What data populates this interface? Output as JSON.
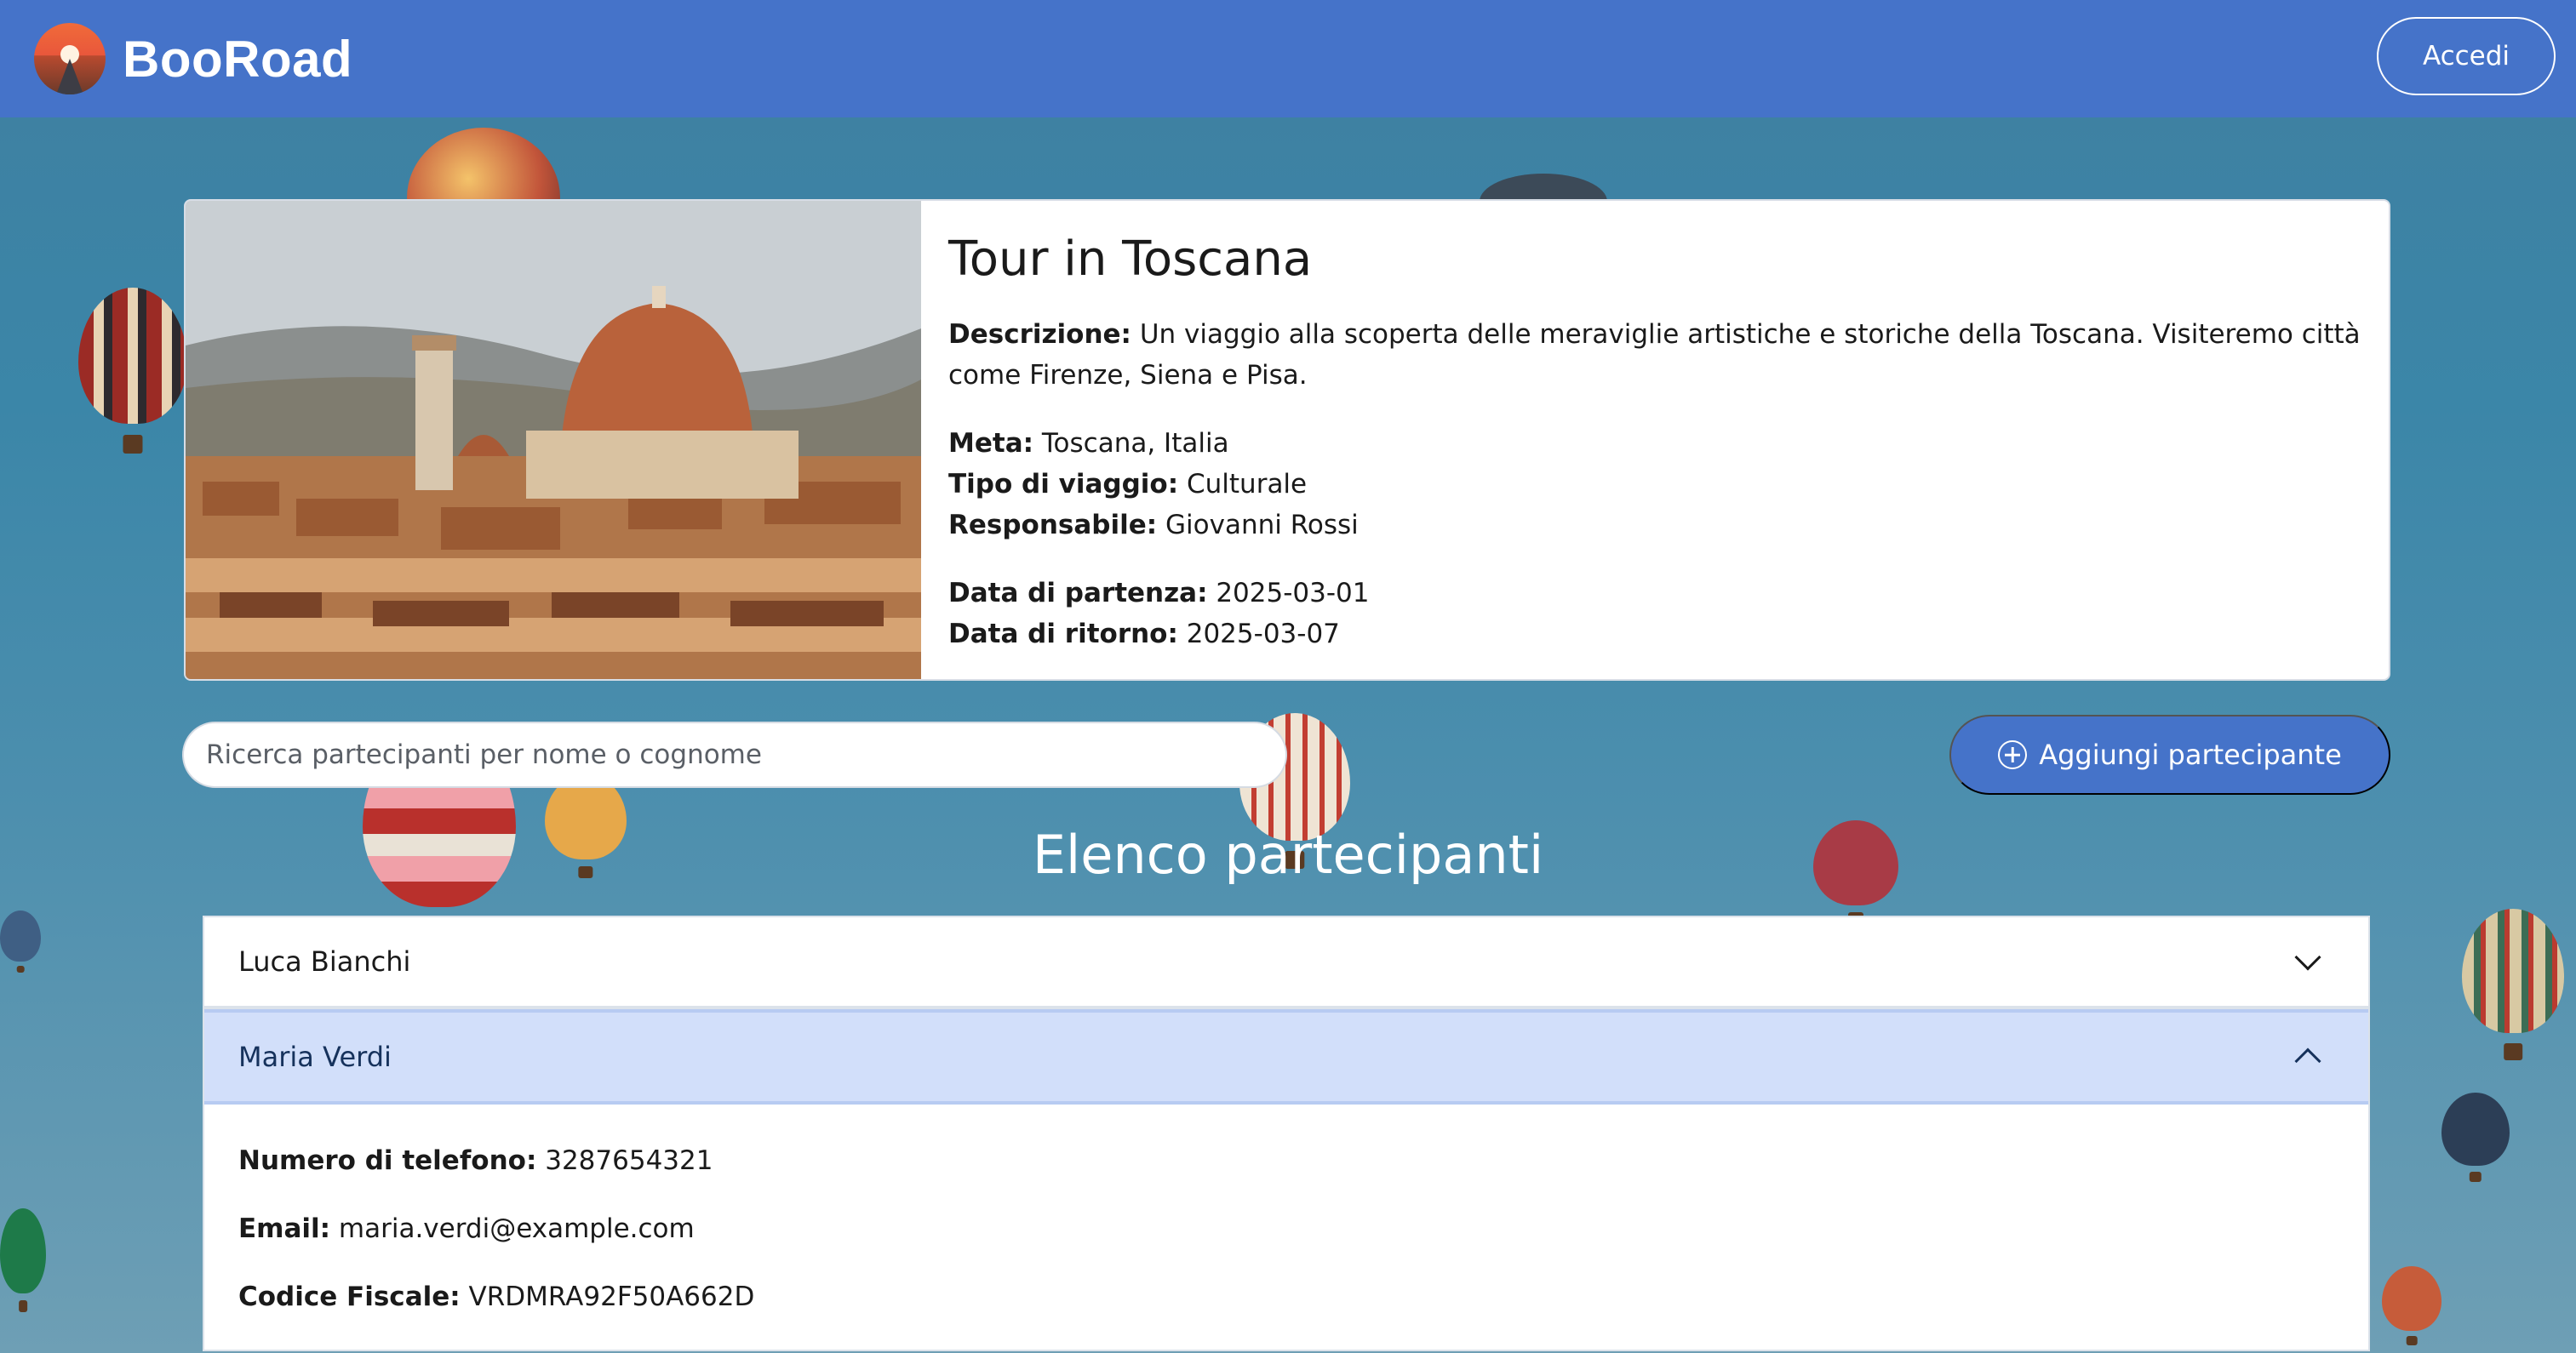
{
  "header": {
    "brand": "BooRoad",
    "login_label": "Accedi",
    "brand_color": "#4573c9"
  },
  "trip": {
    "title": "Tour in Toscana",
    "description_label": "Descrizione:",
    "description": "Un viaggio alla scoperta delle meraviglie artistiche e storiche della Toscana. Visiteremo città come Firenze, Siena e Pisa.",
    "destination_label": "Meta:",
    "destination": "Toscana, Italia",
    "type_label": "Tipo di viaggio:",
    "type": "Culturale",
    "manager_label": "Responsabile:",
    "manager": "Giovanni Rossi",
    "departure_label": "Data di partenza:",
    "departure": "2025-03-01",
    "return_label": "Data di ritorno:",
    "return": "2025-03-07"
  },
  "search": {
    "placeholder": "Ricerca partecipanti per nome o cognome",
    "value": ""
  },
  "add_button": {
    "label": "Aggiungi partecipante",
    "icon": "plus-circle-icon"
  },
  "participants": {
    "title": "Elenco partecipanti",
    "items": [
      {
        "name": "Luca Bianchi",
        "expanded": false
      },
      {
        "name": "Maria Verdi",
        "expanded": true,
        "phone_label": "Numero di telefono:",
        "phone": "3287654321",
        "email_label": "Email:",
        "email": "maria.verdi@example.com",
        "cf_label": "Codice Fiscale:",
        "cf": "VRDMRA92F50A662D"
      }
    ]
  }
}
